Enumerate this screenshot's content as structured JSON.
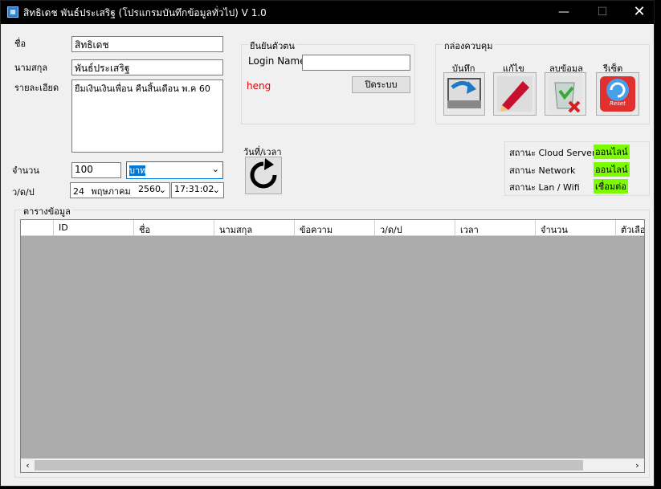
{
  "window": {
    "title": "สิทธิเดช พันธ์ประเสริฐ (โปรแกรมบันทึกข้อมูลทั่วไป) V 1.0",
    "app_icon": "app-icon",
    "minimize_icon": "—",
    "maximize_icon": "☐",
    "close_icon": "✕"
  },
  "form": {
    "name_label": "ชื่อ",
    "name_value": "สิทธิเดช",
    "surname_label": "นามสกุล",
    "surname_value": "พันธ์ประเสริฐ",
    "detail_label": "รายละเอียด",
    "detail_value": "ยืมเงินเงินเพื่อน คืนสิ้นเดือน พ.ค 60",
    "amount_label": "จำนวน",
    "amount_value": "100",
    "unit_selected": "บาท",
    "date_label": "ว/ด/ป",
    "date_day": "24",
    "date_month": "พฤษภาคม",
    "date_year": "2560",
    "time_value": "17:31:02"
  },
  "auth": {
    "group_title": "ยืนยันตัวตน",
    "login_label": "Login Name",
    "login_value": "",
    "user_text": "heng",
    "close_system_button": "ปิดระบบ"
  },
  "datetime_panel": {
    "title": "วันที่/เวลา",
    "refresh_icon": "refresh-icon"
  },
  "control": {
    "group_title": "กล่องควบคุม",
    "buttons": [
      {
        "label": "บันทึก",
        "icon": "save-icon"
      },
      {
        "label": "แก้ไข",
        "icon": "edit-icon"
      },
      {
        "label": "ลบข้อมูล",
        "icon": "delete-icon"
      },
      {
        "label": "รีเซ็ต",
        "icon": "reset-icon",
        "icon_text": "Reset"
      }
    ]
  },
  "status": {
    "cloud_label": "สถานะ Cloud Server",
    "cloud_value": "ออนไลน์",
    "network_label": "สถานะ Network",
    "network_value": "ออนไลน์",
    "lan_label": "สถานะ Lan / Wifi",
    "lan_value": "เชื่อมต่อ",
    "ok_color": "#7cfc00"
  },
  "table": {
    "group_title": "ตารางข้อมูล",
    "columns": [
      "",
      "ID",
      "ชื่อ",
      "นามสกุล",
      "ข้อความ",
      "ว/ด/ป",
      "เวลา",
      "จำนวน",
      "ตัวเลือก"
    ],
    "rows": []
  }
}
